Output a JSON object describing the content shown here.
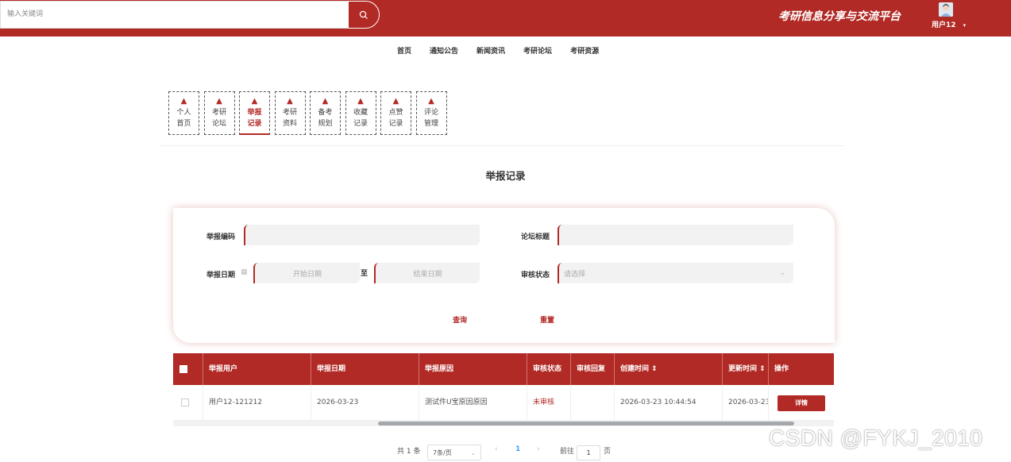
{
  "header": {
    "search_placeholder": "输入关键词",
    "site_title": "考研信息分享与交流平台",
    "username": "用户12"
  },
  "nav": {
    "items": [
      "首页",
      "通知公告",
      "新闻资讯",
      "考研论坛",
      "考研资源"
    ]
  },
  "side_tabs": {
    "items": [
      {
        "label": "个人首页"
      },
      {
        "label": "考研论坛"
      },
      {
        "label": "举报记录",
        "active": true
      },
      {
        "label": "考研资料"
      },
      {
        "label": "备考规划"
      },
      {
        "label": "收藏记录"
      },
      {
        "label": "点赞记录"
      },
      {
        "label": "评论管理"
      }
    ]
  },
  "page": {
    "title": "举报记录"
  },
  "form": {
    "report_no_label": "举报编码",
    "forum_title_label": "论坛标题",
    "report_date_label": "举报日期",
    "start_date_placeholder": "开始日期",
    "to_label": "至",
    "end_date_placeholder": "结束日期",
    "status_label": "审核状态",
    "status_placeholder": "请选择",
    "query_label": "查询",
    "reset_label": "重置"
  },
  "table": {
    "columns": [
      "举报用户",
      "举报日期",
      "举报原因",
      "审核状态",
      "审核回复",
      "创建时间",
      "更新时间",
      "操作"
    ],
    "rows": [
      {
        "user": "用户12-121212",
        "date": "2026-03-23",
        "reason": "测试件U宝原因原因",
        "status": "未审核",
        "reply": "",
        "created": "2026-03-23 10:44:54",
        "updated": "2026-03-23",
        "action": "详情"
      }
    ]
  },
  "pagination": {
    "total": "共 1 条",
    "page_size": "7条/页",
    "current": "1",
    "goto_label": "前往",
    "goto_value": "1",
    "page_suffix": "页"
  },
  "watermark": "CSDN @FYKJ_2010",
  "colors": {
    "primary": "#b22a25"
  }
}
